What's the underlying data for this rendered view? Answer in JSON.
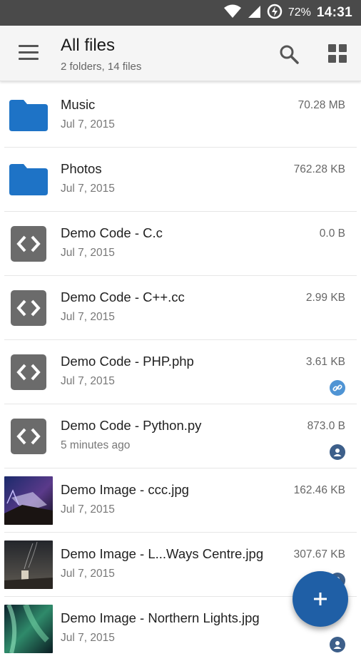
{
  "status_bar": {
    "battery": "72%",
    "time": "14:31"
  },
  "header": {
    "title": "All files",
    "subtitle": "2 folders, 14 files"
  },
  "colors": {
    "accent": "#1f5fa6",
    "folder": "#1e73c6",
    "link_badge": "#4f94d4",
    "user_badge": "#3d5f8a"
  },
  "files": [
    {
      "name": "Music",
      "date": "Jul 7, 2015",
      "size": "70.28 MB",
      "type": "folder",
      "badge": ""
    },
    {
      "name": "Photos",
      "date": "Jul 7, 2015",
      "size": "762.28 KB",
      "type": "folder",
      "badge": ""
    },
    {
      "name": "Demo Code - C.c",
      "date": "Jul 7, 2015",
      "size": "0.0 B",
      "type": "code",
      "badge": ""
    },
    {
      "name": "Demo Code - C++.cc",
      "date": "Jul 7, 2015",
      "size": "2.99 KB",
      "type": "code",
      "badge": ""
    },
    {
      "name": "Demo Code - PHP.php",
      "date": "Jul 7, 2015",
      "size": "3.61 KB",
      "type": "code",
      "badge": "link-icon"
    },
    {
      "name": "Demo Code - Python.py",
      "date": "5 minutes ago",
      "size": "873.0 B",
      "type": "code",
      "badge": "user-icon"
    },
    {
      "name": "Demo Image - ccc.jpg",
      "date": "Jul 7, 2015",
      "size": "162.46 KB",
      "type": "image",
      "badge": ""
    },
    {
      "name": "Demo Image - L...Ways Centre.jpg",
      "date": "Jul 7, 2015",
      "size": "307.67 KB",
      "type": "image",
      "badge": "user-icon"
    },
    {
      "name": "Demo Image - Northern Lights.jpg",
      "date": "Jul 7, 2015",
      "size": "",
      "type": "image",
      "badge": "user-icon"
    }
  ]
}
